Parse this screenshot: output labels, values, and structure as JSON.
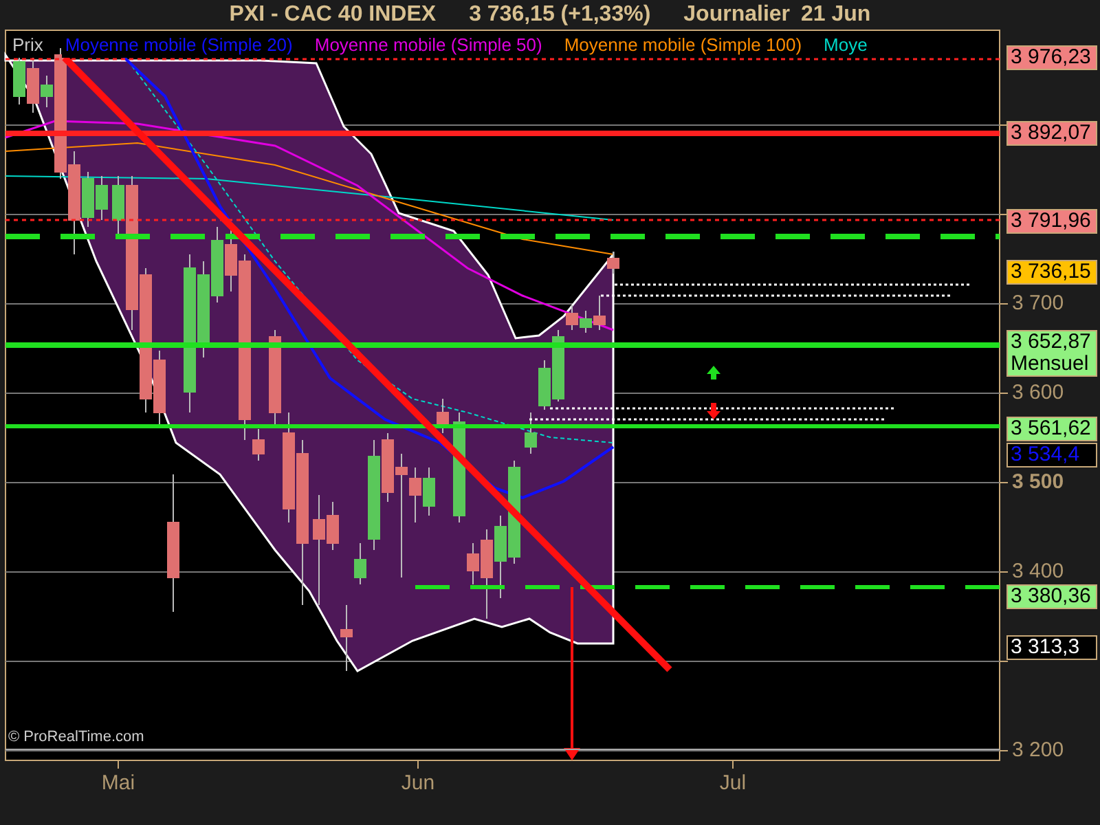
{
  "header": {
    "symbol": "PXI - CAC 40 INDEX",
    "price": "3 736,15 (+1,33%)",
    "period": "Journalier",
    "date": "21 Jun"
  },
  "legend": [
    {
      "label": "Prix",
      "color": "#c8c8c8"
    },
    {
      "label": "Moyenne mobile (Simple 20)",
      "color": "#1010ff"
    },
    {
      "label": "Moyenne mobile (Simple 50)",
      "color": "#e000e0"
    },
    {
      "label": "Moyenne mobile (Simple 100)",
      "color": "#ff8c00"
    },
    {
      "label": "Moye",
      "color": "#00d8c8"
    }
  ],
  "price_axis": [
    {
      "label": "3 700",
      "bold": false
    },
    {
      "label": "3 600",
      "bold": false
    },
    {
      "label": "3 500",
      "bold": true
    },
    {
      "label": "3 400",
      "bold": false
    },
    {
      "label": "3 200",
      "bold": false
    }
  ],
  "price_tags": [
    {
      "label": "3 976,23",
      "kind": "resistance"
    },
    {
      "label": "3 892,07",
      "kind": "resistance"
    },
    {
      "label": "3 791,96",
      "kind": "resistance"
    },
    {
      "label": "3 736,15",
      "kind": "last"
    },
    {
      "label": "3 652,87",
      "note": "Mensuel",
      "kind": "support"
    },
    {
      "label": "3 561,62",
      "kind": "support"
    },
    {
      "label": "3 534,4",
      "kind": "average"
    },
    {
      "label": "3 380,36",
      "kind": "support"
    },
    {
      "label": "3 313,3",
      "kind": "band"
    }
  ],
  "time_axis": [
    {
      "label": "Mai"
    },
    {
      "label": "Jun"
    },
    {
      "label": "Jul"
    }
  ],
  "copyright": "© ProRealTime.com"
}
